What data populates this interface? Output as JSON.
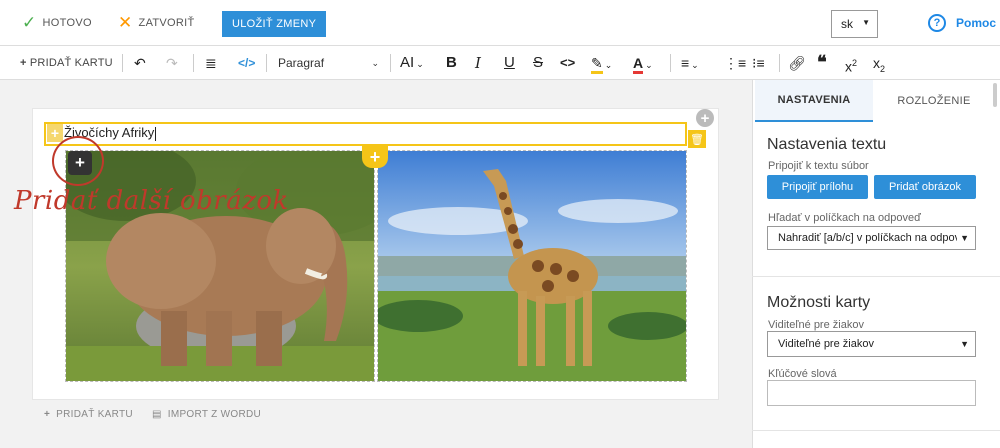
{
  "topbar": {
    "done_label": "HOTOVO",
    "close_label": "ZATVORIŤ",
    "save_label": "ULOŽIŤ ZMENY",
    "language": "sk",
    "help_label": "Pomoc"
  },
  "toolbar": {
    "add_card_label": "PRIDAŤ KARTU",
    "paragraph_style": "Paragraf",
    "icons": [
      "undo-icon",
      "redo-icon",
      "database-icon",
      "code-view-icon",
      "font-size-icon",
      "bold-icon",
      "italic-icon",
      "underline-icon",
      "strikethrough-icon",
      "code-icon",
      "highlight-icon",
      "font-color-icon",
      "align-icon",
      "ordered-list-icon",
      "bullet-list-icon",
      "link-icon",
      "quote-icon",
      "superscript-icon",
      "subscript-icon"
    ]
  },
  "card": {
    "title": "Živočíchy Afriky",
    "images": [
      "elephant",
      "giraffe"
    ]
  },
  "annotation": "Pridať další obrázok",
  "footer": {
    "add_card_label": "PRIDAŤ KARTU",
    "import_label": "IMPORT Z WORDU"
  },
  "panel": {
    "tabs": [
      "NASTAVENIA",
      "ROZLOŽENIE"
    ],
    "text_settings_title": "Nastavenia textu",
    "attach_label": "Pripojiť k textu súbor",
    "attach_button": "Pripojiť prílohu",
    "add_image_button": "Pridať obrázok",
    "search_label": "Hľadať v políčkach na odpoveď",
    "search_value": "Nahradiť [a/b/c] v políčkach na odpove",
    "card_options_title": "Možnosti karty",
    "visibility_label": "Viditeľné pre žiakov",
    "visibility_value": "Viditeľné pre žiakov",
    "keywords_label": "Kľúčové slová",
    "keywords_value": ""
  },
  "colors": {
    "accent": "#2e8fd8",
    "highlight": "#f5c518",
    "annotation": "#c0392b"
  }
}
